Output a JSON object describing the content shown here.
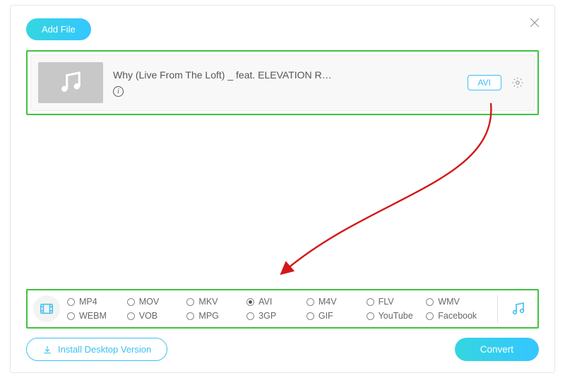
{
  "header": {
    "add_file_label": "Add File"
  },
  "file": {
    "title": "Why (Live From The Loft) _ feat. ELEVATION R…",
    "format_badge": "AVI"
  },
  "formats": {
    "row1": [
      "MP4",
      "MOV",
      "MKV",
      "AVI",
      "M4V",
      "FLV",
      "WMV"
    ],
    "row2": [
      "WEBM",
      "VOB",
      "MPG",
      "3GP",
      "GIF",
      "YouTube",
      "Facebook"
    ],
    "selected": "AVI"
  },
  "footer": {
    "install_label": "Install Desktop Version",
    "convert_label": "Convert"
  }
}
